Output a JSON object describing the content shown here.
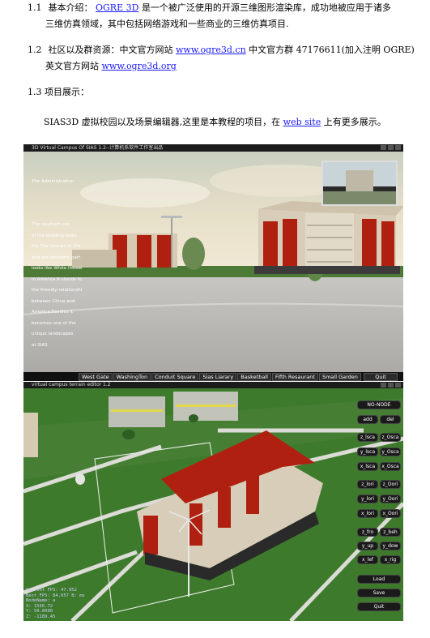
{
  "s11": {
    "num": "1.1",
    "prefix": "基本介绍：",
    "link": "OGRE 3D",
    "text1": "是一个被广泛使用的开源三维图形渲染库，成功地被应用于诸多",
    "text2": "三维仿真领域，其中包括网络游戏和一些商业的三维仿真项目."
  },
  "s12": {
    "num": "1.2",
    "prefix": "社区以及群资源：中文官方网站",
    "link1": "www.ogre3d.cn",
    "mid": "中文官方群 47176611(加入注明 OGRE)",
    "line2": "英文官方网站",
    "link2": "www.ogre3d.org"
  },
  "s13": {
    "heading": "1.3 项目展示：",
    "text1": "SIAS3D 虚拟校园以及场景编辑器,这里是本教程的项目，在",
    "link": "web site",
    "text2": "上有更多展示。"
  },
  "shot1": {
    "title": "3D Virtual Campus Of SIAS 1.2--计算机系软件工作室出品",
    "overlay_title": "The Administration",
    "overlay_lines": [
      "The southern par",
      "of the building looks",
      "the Tian'anmen in Chi",
      "and the southern part",
      "looks like White House",
      "in America.It stands fo",
      "the friendly relationshi",
      "between China and",
      "America.Besides it",
      "becomes one of the",
      "unique landscapes",
      "at SIAS"
    ],
    "buttons": [
      "West Gate",
      "WashingTon",
      "Conduit Square",
      "Sias Liarary",
      "Basketball",
      "Fifth Resaurant",
      "Small Garden"
    ],
    "quit": "Quit"
  },
  "shot2": {
    "title": "virtual campus terrain editor 1.2",
    "side_top": "NO-NODE",
    "side_pairs": [
      [
        "add",
        "del"
      ],
      [
        "z_lsca",
        "z_Osca"
      ],
      [
        "y_lsca",
        "y_Osca"
      ],
      [
        "x_lsca",
        "x_Osca"
      ],
      [
        "z_lori",
        "z_Oori"
      ],
      [
        "y_lori",
        "y_Oori"
      ],
      [
        "x_lori",
        "x_Oori"
      ],
      [
        "z_fro",
        "z_beh"
      ],
      [
        "y_up",
        "y_dow"
      ],
      [
        "x_lef",
        "x_rig"
      ]
    ],
    "side_bottom": [
      "Load",
      "Save",
      "Quit"
    ],
    "status": [
      "Current FPS: 47.952",
      "Best FPS: 84.057 B: ms",
      "NodeName: a",
      "X: 1556.72",
      "Y: 50.6000",
      "Z: -1189.45"
    ]
  },
  "colors": {
    "link": "#1a1aff",
    "roof": "#b02010",
    "wall": "#d8cdb8",
    "grass": "#3e7a2c"
  }
}
